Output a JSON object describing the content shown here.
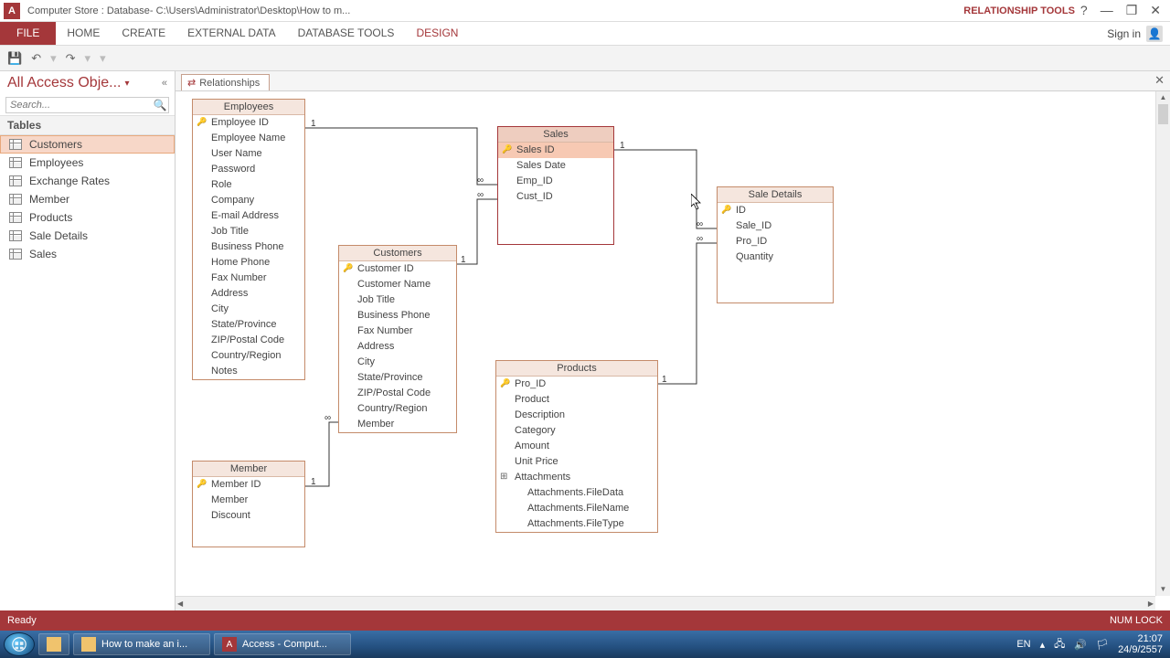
{
  "titlebar": {
    "app_letter": "A",
    "title": "Computer Store : Database- C:\\Users\\Administrator\\Desktop\\How to m...",
    "contextual": "RELATIONSHIP TOOLS",
    "help": "?",
    "minimize": "—",
    "restore": "❐",
    "close": "✕"
  },
  "ribbon": {
    "file": "FILE",
    "tabs": [
      "HOME",
      "CREATE",
      "EXTERNAL DATA",
      "DATABASE TOOLS"
    ],
    "contextual": "DESIGN",
    "signin": "Sign in"
  },
  "qat": {
    "save": "💾",
    "undo": "↶",
    "redo": "↷"
  },
  "nav": {
    "header": "All Access Obje...",
    "search_placeholder": "Search...",
    "group": "Tables",
    "items": [
      "Customers",
      "Employees",
      "Exchange Rates",
      "Member",
      "Products",
      "Sale Details",
      "Sales"
    ],
    "selected_index": 0
  },
  "doc": {
    "tab": "Relationships"
  },
  "tables": {
    "employees": {
      "title": "Employees",
      "fields": [
        "Employee ID",
        "Employee Name",
        "User Name",
        "Password",
        "Role",
        "Company",
        "E-mail Address",
        "Job Title",
        "Business Phone",
        "Home Phone",
        "Fax Number",
        "Address",
        "City",
        "State/Province",
        "ZIP/Postal Code",
        "Country/Region",
        "Notes"
      ],
      "pk": [
        0
      ]
    },
    "customers": {
      "title": "Customers",
      "fields": [
        "Customer ID",
        "Customer Name",
        "Job Title",
        "Business Phone",
        "Fax Number",
        "Address",
        "City",
        "State/Province",
        "ZIP/Postal Code",
        "Country/Region",
        "Member"
      ],
      "pk": [
        0
      ]
    },
    "member": {
      "title": "Member",
      "fields": [
        "Member ID",
        "Member",
        "Discount"
      ],
      "pk": [
        0
      ]
    },
    "sales": {
      "title": "Sales",
      "fields": [
        "Sales ID",
        "Sales Date",
        "Emp_ID",
        "Cust_ID"
      ],
      "pk": [
        0
      ],
      "sel": 0
    },
    "products": {
      "title": "Products",
      "fields": [
        "Pro_ID",
        "Product",
        "Description",
        "Category",
        "Amount",
        "Unit Price",
        "Attachments",
        "Attachments.FileData",
        "Attachments.FileName",
        "Attachments.FileType"
      ],
      "pk": [
        0
      ],
      "exp": 6,
      "indent": [
        7,
        8,
        9
      ]
    },
    "saledetails": {
      "title": "Sale Details",
      "fields": [
        "ID",
        "Sale_ID",
        "Pro_ID",
        "Quantity"
      ],
      "pk": [
        0
      ]
    }
  },
  "statusbar": {
    "left": "Ready",
    "right": "NUM LOCK"
  },
  "taskbar": {
    "items": [
      {
        "icon": "folder",
        "label": "How to make an i..."
      },
      {
        "icon": "access",
        "label": "Access - Comput..."
      }
    ],
    "lang": "EN",
    "time": "21:07",
    "date": "24/9/2557"
  }
}
